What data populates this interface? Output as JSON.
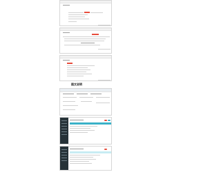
{
  "caption": "图文说明",
  "screens": [
    {
      "name": "form-screen-1"
    },
    {
      "name": "table-screen-2"
    },
    {
      "name": "list-screen-3"
    },
    {
      "name": "dashboard-screen-4"
    },
    {
      "name": "admin-screen-5"
    },
    {
      "name": "admin-screen-6"
    }
  ],
  "colors": {
    "accent_red": "#e74c3c",
    "accent_cyan": "#3ab1c8",
    "sidebar_dark": "#263238"
  }
}
